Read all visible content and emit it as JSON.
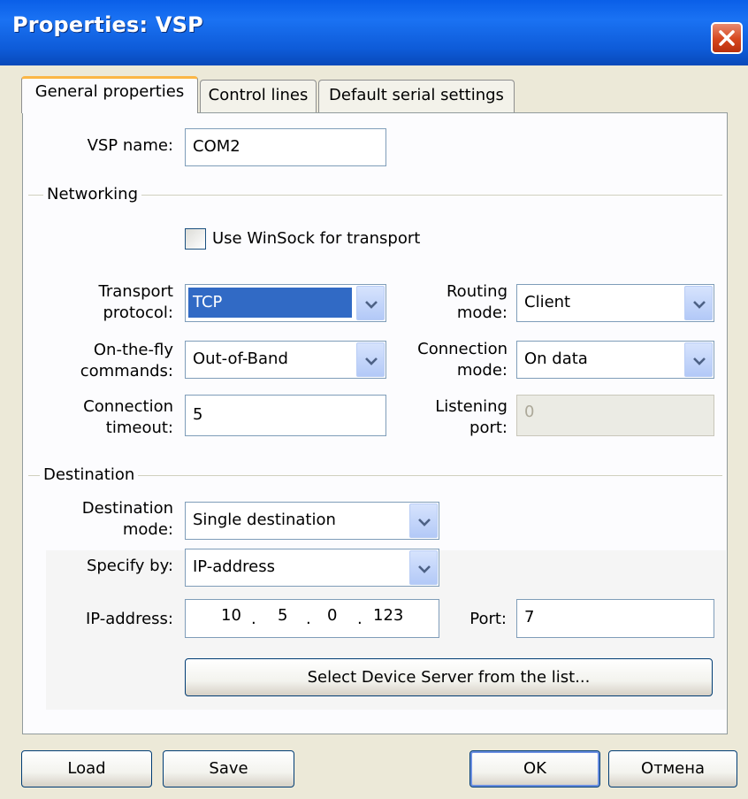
{
  "window": {
    "title": "Properties: VSP",
    "close_icon": "close-icon"
  },
  "tabs": [
    {
      "label": "General properties",
      "active": true
    },
    {
      "label": "Control lines",
      "active": false
    },
    {
      "label": "Default serial settings",
      "active": false
    }
  ],
  "general": {
    "vsp_name_label": "VSP name:",
    "vsp_name_value": "COM2"
  },
  "networking": {
    "group_label": "Networking",
    "winsock_label": "Use WinSock for transport",
    "winsock_checked": false,
    "transport_protocol_label": "Transport protocol:",
    "transport_protocol_value": "TCP",
    "routing_mode_label": "Routing mode:",
    "routing_mode_value": "Client",
    "on_the_fly_label": "On-the-fly commands:",
    "on_the_fly_value": "Out-of-Band",
    "connection_mode_label": "Connection mode:",
    "connection_mode_value": "On data",
    "connection_timeout_label": "Connection timeout:",
    "connection_timeout_value": "5",
    "listening_port_label": "Listening port:",
    "listening_port_value": "0"
  },
  "destination": {
    "group_label": "Destination",
    "destination_mode_label": "Destination mode:",
    "destination_mode_value": "Single destination",
    "specify_by_label": "Specify by:",
    "specify_by_value": "IP-address",
    "ip_address_label": "IP-address:",
    "ip_octets": [
      "10",
      "5",
      "0",
      "123"
    ],
    "ip_dot": ".",
    "port_label": "Port:",
    "port_value": "7",
    "select_device_button": "Select Device Server from the list..."
  },
  "footer": {
    "load_button": "Load",
    "save_button": "Save",
    "ok_button": "OK",
    "cancel_button": "Отмена"
  },
  "colors": {
    "titlebar": "#0a5fe8",
    "selection": "#316ac5",
    "tab_active_accent": "#fbb646",
    "close_button": "#d6461d"
  }
}
